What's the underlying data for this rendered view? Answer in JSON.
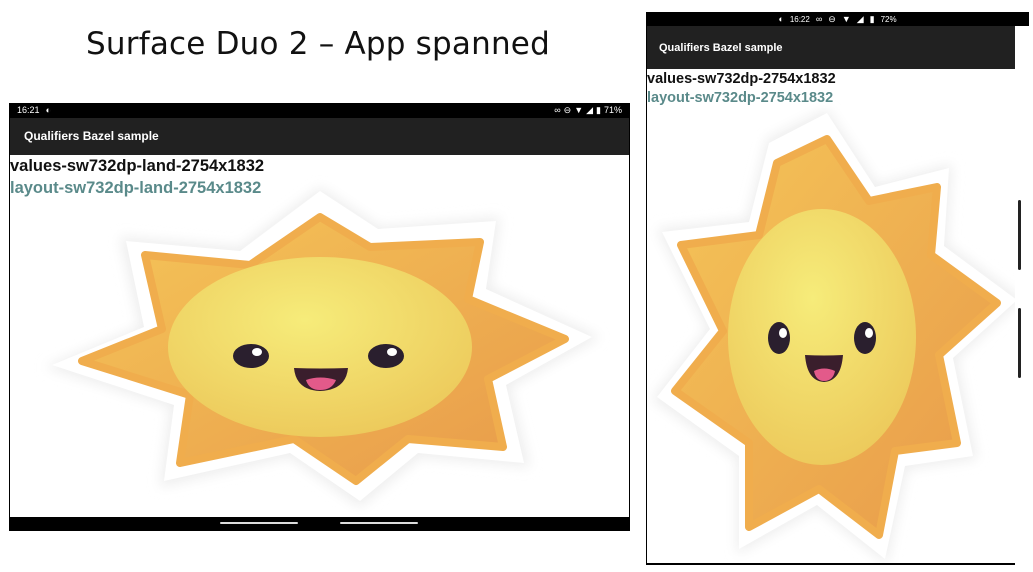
{
  "slide": {
    "title": "Surface Duo 2 – App spanned"
  },
  "landscape": {
    "status_time": "16:21",
    "battery": "71%",
    "app_title": "Qualifiers Bazel sample",
    "values_qualifier": "values-sw732dp-land-2754x1832",
    "layout_qualifier": "layout-sw732dp-land-2754x1832"
  },
  "portrait": {
    "status_time": "16:22",
    "battery": "72%",
    "app_title": "Qualifiers Bazel sample",
    "values_qualifier": "values-sw732dp-2754x1832",
    "layout_qualifier": "layout-sw732dp-2754x1832"
  },
  "icons": {
    "status_app_icon": "circle-half-icon",
    "link_icon": "link-icon",
    "dnd_icon": "do-not-disturb-icon",
    "wifi_icon": "wifi-icon",
    "signal_icon": "signal-icon",
    "battery_icon": "battery-icon",
    "sun_image": "smiling-sun-sticker"
  },
  "colors": {
    "appbar": "#212121",
    "layout_text": "#5a8a8a",
    "sun_outer": "#f2b451",
    "sun_face": "#f3df6f"
  }
}
